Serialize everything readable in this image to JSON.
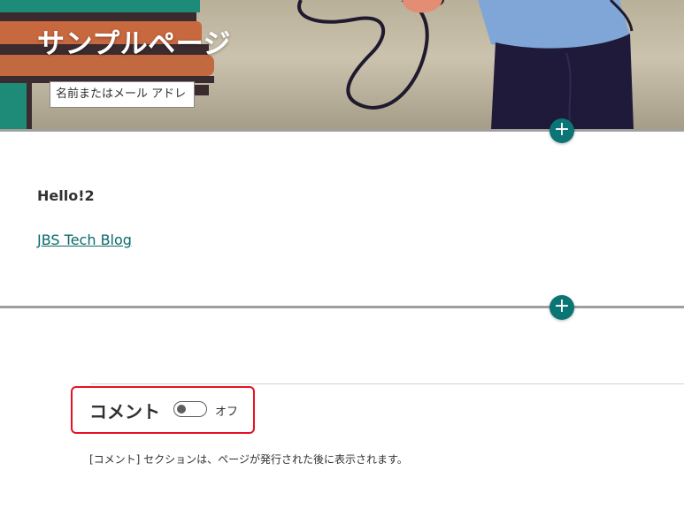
{
  "hero": {
    "title": "サンプルページ",
    "author_placeholder": "名前またはメール アドレ"
  },
  "content": {
    "greeting": "Hello!2",
    "link_text": "JBS Tech Blog"
  },
  "add_section_icon": "plus-icon",
  "comments": {
    "heading": "コメント",
    "toggle_state": "オフ",
    "toggle_on": false,
    "note": "[コメント] セクションは、ページが発行された後に表示されます。"
  },
  "colors": {
    "accent": "#0b7474",
    "link": "#0b6a6a",
    "highlight": "#e81123"
  }
}
